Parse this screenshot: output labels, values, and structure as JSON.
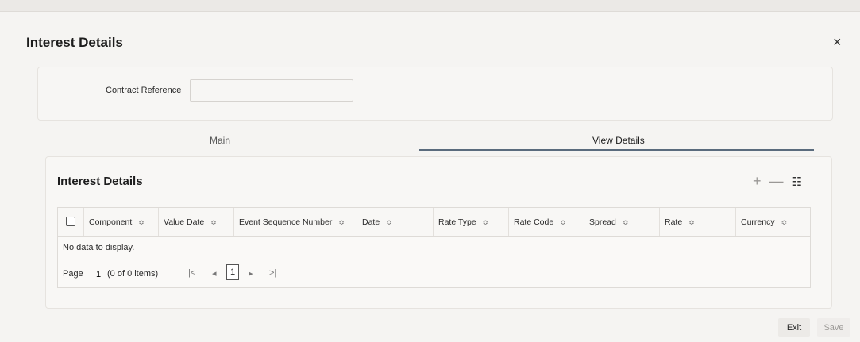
{
  "window": {
    "title": "Interest Details",
    "close_glyph": "×"
  },
  "reference": {
    "label": "Contract Reference",
    "value": ""
  },
  "tabs": [
    {
      "label": "Main",
      "active": false
    },
    {
      "label": "View Details",
      "active": true
    }
  ],
  "grid": {
    "title": "Interest Details",
    "actions": {
      "add": "+",
      "remove": "—",
      "columns": "☷"
    },
    "columns": [
      "Component",
      "Value Date",
      "Event Sequence Number",
      "Date",
      "Rate Type",
      "Rate Code",
      "Spread",
      "Rate",
      "Currency"
    ],
    "sort_glyph": "≎",
    "empty_message": "No data to display.",
    "pager": {
      "page_label": "Page",
      "page_value": "1",
      "count_text": "(0 of 0 items)",
      "first": "|<",
      "prev": "◂",
      "current": "1",
      "next": "▸",
      "last": ">|"
    }
  },
  "footer": {
    "exit_label": "Exit",
    "save_label": "Save"
  },
  "icons": {
    "close": "close-icon",
    "add": "plus-icon",
    "remove": "minus-icon",
    "columns": "list-icon"
  }
}
